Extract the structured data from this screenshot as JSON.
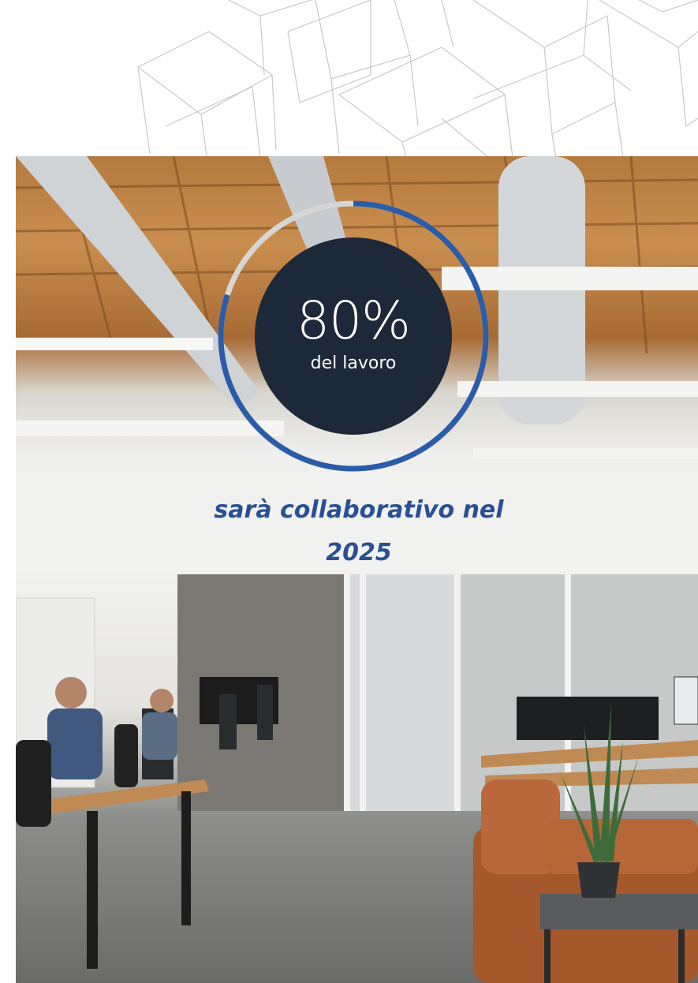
{
  "stat": {
    "value": "80%",
    "caption": "del lavoro",
    "progress_fraction": 0.8
  },
  "headline": {
    "line1": "sarà collaborativo nel",
    "line2": "2025"
  },
  "colors": {
    "circle_fill": "#1d2938",
    "ring_active": "#2a5ca8",
    "ring_track": "#d6d6d6",
    "headline": "#2a4f93"
  },
  "image": {
    "subject": "open-plan-office-photo",
    "decor": "wireframe-cubes-pattern"
  }
}
